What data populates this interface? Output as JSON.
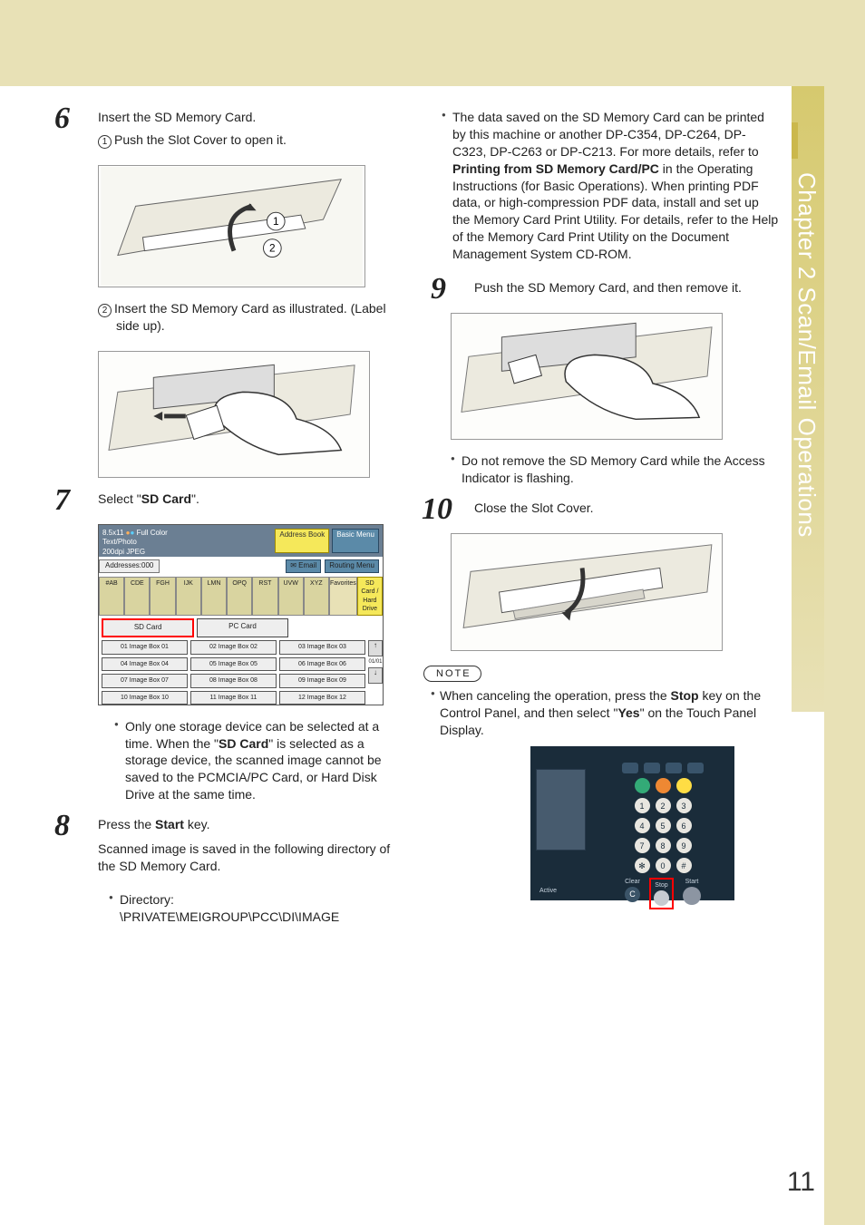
{
  "chapter": {
    "label": "Chapter 2   Scan/Email Operations"
  },
  "page_number": "11",
  "steps": {
    "6": {
      "title": "Insert the SD Memory Card.",
      "sub1_marker": "1",
      "sub1": "Push the Slot Cover to open it.",
      "sub2_marker": "2",
      "sub2": "Insert the SD Memory Card as illustrated. (Label side up)."
    },
    "7": {
      "title_pre": "Select \"",
      "title_bold": "SD Card",
      "title_post": "\".",
      "bullet_pre": "Only one storage device can be selected at a time. When the \"",
      "bullet_bold": "SD Card",
      "bullet_post": "\" is selected as a storage device, the scanned image cannot be saved to the PCMCIA/PC Card, or Hard Disk Drive at the same time."
    },
    "8": {
      "title_pre": "Press the ",
      "title_bold": "Start",
      "title_post": " key.",
      "body": "Scanned image is saved in the following directory of the SD Memory Card.",
      "dir_label": "Directory:",
      "dir_path": "\\PRIVATE\\MEIGROUP\\PCC\\DI\\IMAGE",
      "bullet2_pre": "The data saved on the SD Memory Card can be printed by this machine or another DP-C354, DP-C264, DP-C323, DP-C263 or DP-C213. For more details, refer to ",
      "bullet2_bold": "Printing from SD Memory Card/PC",
      "bullet2_post": " in the Operating Instructions (for Basic Operations). When printing PDF data, or high-compression PDF data, install and set up the Memory Card Print Utility. For details, refer to the Help of the Memory Card Print Utility on the Document Management System CD-ROM."
    },
    "9": {
      "title": "Push the SD Memory Card, and then remove it.",
      "bullet": "Do not remove the SD Memory Card while the Access Indicator is flashing."
    },
    "10": {
      "title": "Close the Slot Cover."
    }
  },
  "note": {
    "label": "NOTE",
    "text_pre": "When canceling the operation, press the ",
    "bold1": "Stop",
    "text_mid": " key on the Control Panel, and then select \"",
    "bold2": "Yes",
    "text_post": "\" on the Touch Panel Display."
  },
  "lcd": {
    "paper": "8.5x11",
    "color": "Full Color",
    "mode": "Text/Photo",
    "res": "200dpi JPEG",
    "addr": "Addresses:000",
    "btn_addrbook": "Address Book",
    "btn_basic": "Basic Menu",
    "btn_email": "Email",
    "btn_routing": "Routing Menu",
    "tabs": [
      "#AB",
      "CDE",
      "FGH",
      "IJK",
      "LMN",
      "OPQ",
      "RST",
      "UVW",
      "XYZ"
    ],
    "tab_fav": "Favorites",
    "tab_sd": "SD Card / Hard Drive",
    "sel_sd": "SD Card",
    "sel_pc": "PC Card",
    "boxes": [
      "01 Image Box 01",
      "02 Image Box 02",
      "03 Image Box 03",
      "04 Image Box 04",
      "05 Image Box 05",
      "06 Image Box 06",
      "07 Image Box 07",
      "08 Image Box 08",
      "09 Image Box 09",
      "10 Image Box 10",
      "11 Image Box 11",
      "12 Image Box 12"
    ],
    "scroll_ind": "01/01"
  },
  "panel": {
    "clear": "Clear",
    "stop": "Stop",
    "start": "Start",
    "active": "Active"
  }
}
